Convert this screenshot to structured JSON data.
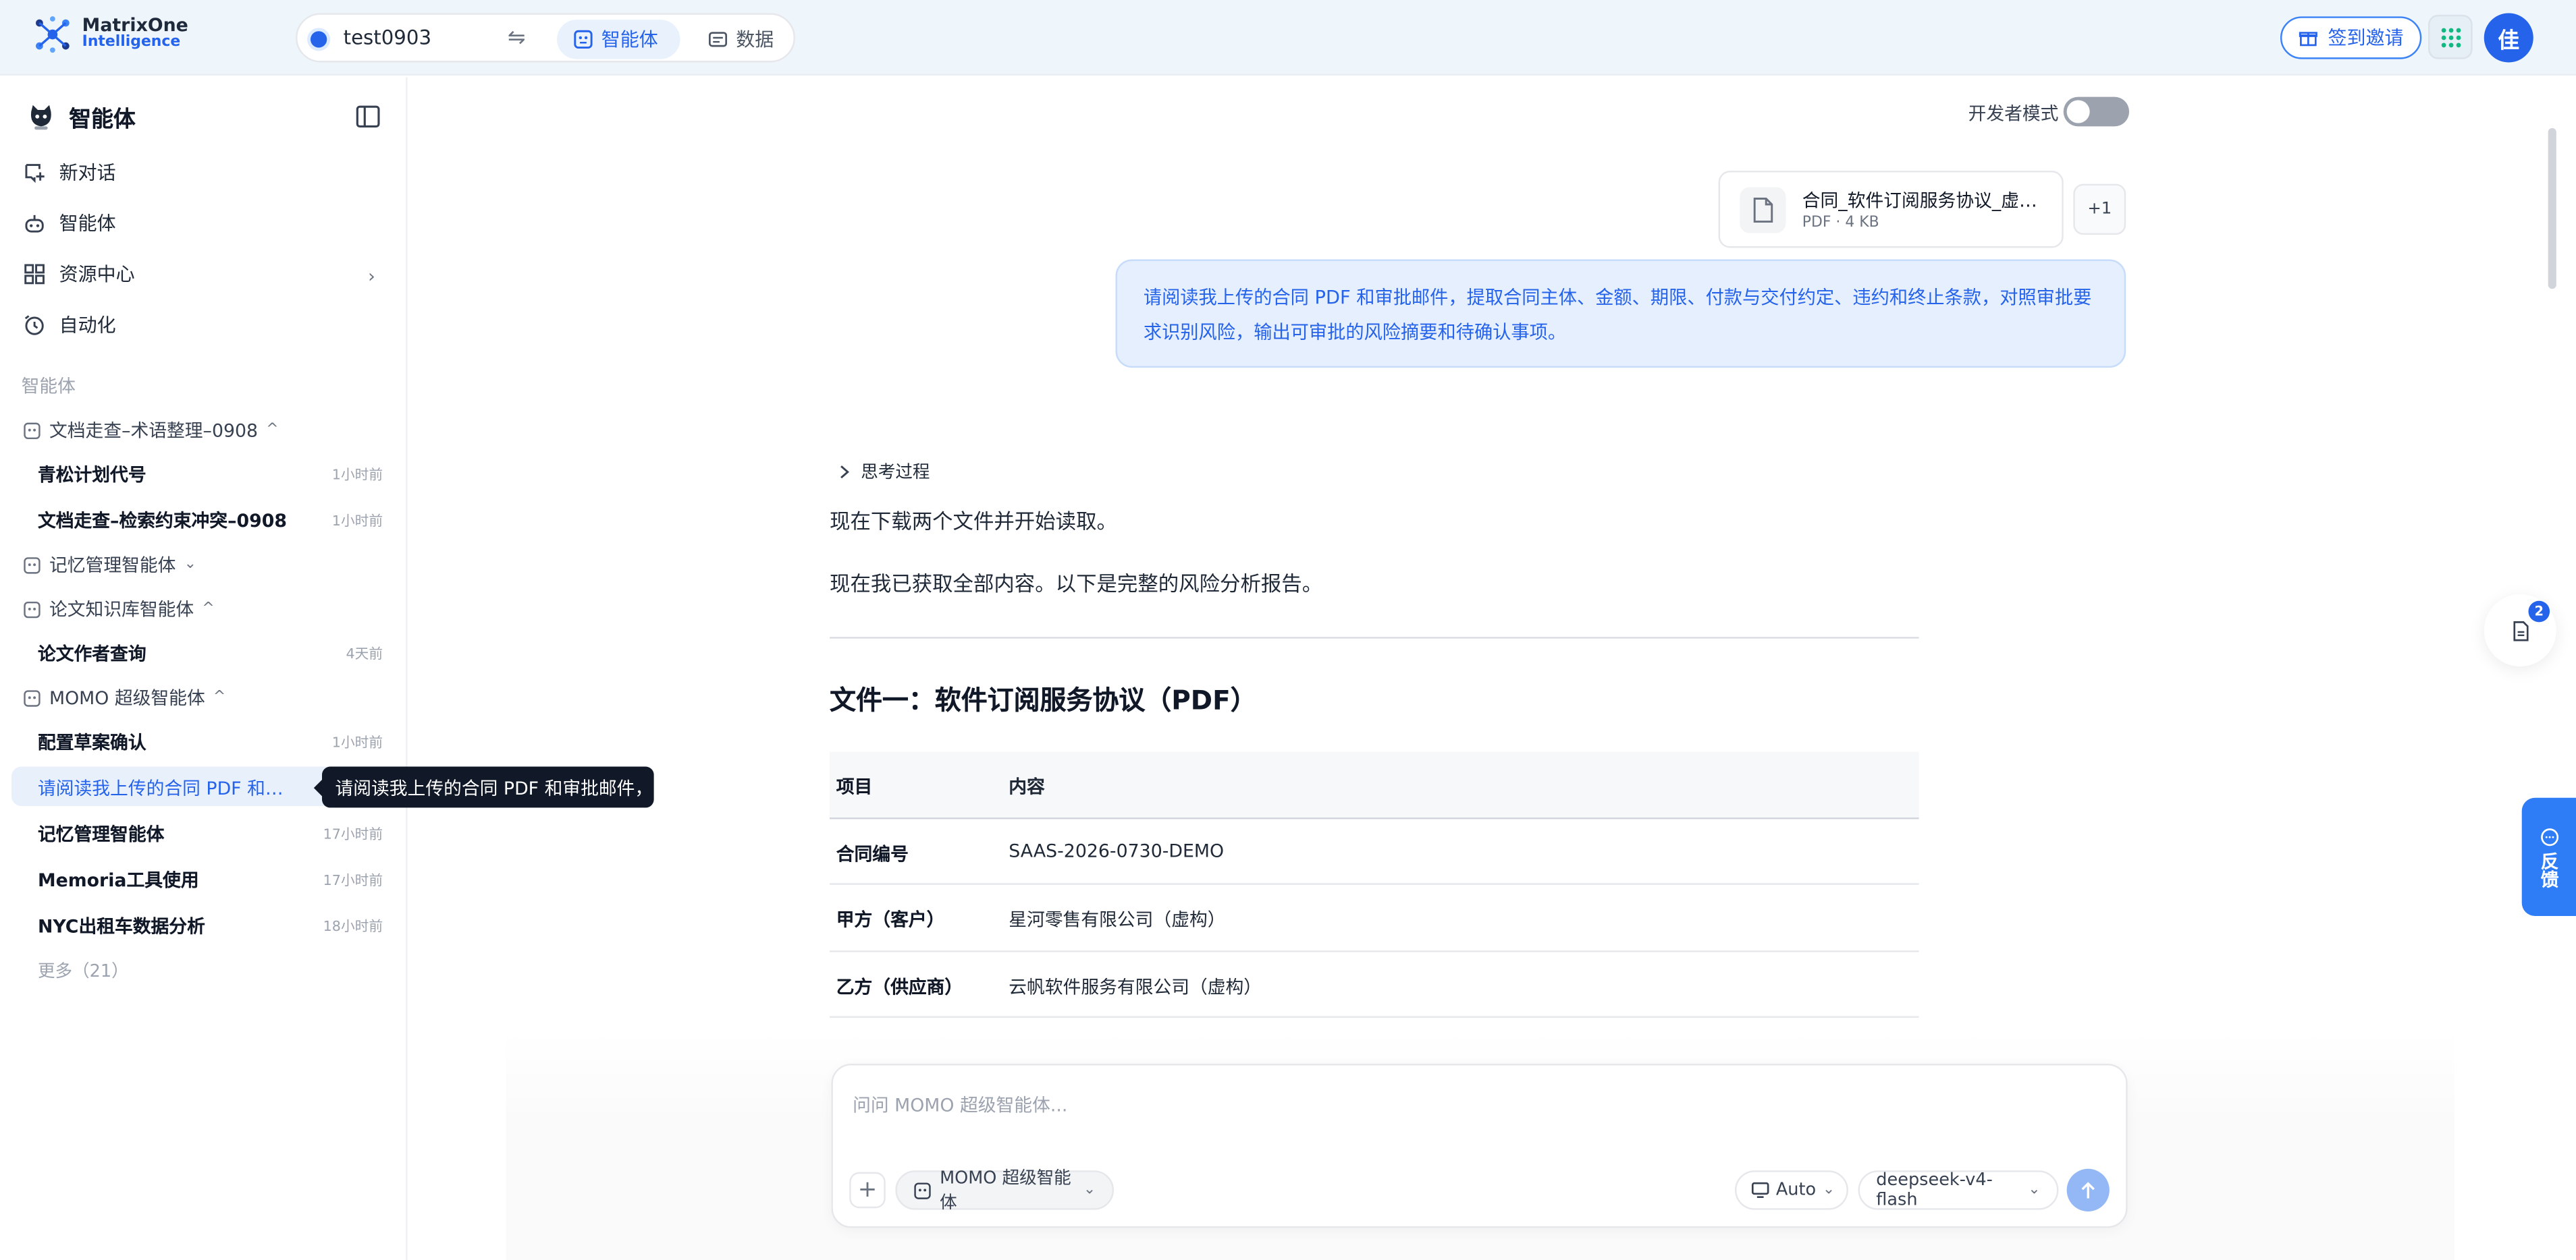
{
  "header": {
    "logo_line1": "MatrixOne",
    "logo_line2": "Intelligence",
    "workspace": "test0903",
    "tabs": [
      {
        "label": "智能体",
        "active": true
      },
      {
        "label": "数据",
        "active": false
      }
    ],
    "invite_label": "签到邀请",
    "avatar_text": "佳"
  },
  "sidebar": {
    "title": "智能体",
    "menu": [
      {
        "label": "新对话",
        "icon": "new-chat-icon"
      },
      {
        "label": "智能体",
        "icon": "agent-icon"
      },
      {
        "label": "资源中心",
        "icon": "grid-icon"
      },
      {
        "label": "自动化",
        "icon": "alarm-clock-icon"
      }
    ],
    "section_label": "智能体",
    "groups": [
      {
        "label": "文档走查–术语整理–0908",
        "expanded": true
      },
      {
        "label": "记忆管理智能体",
        "expanded": false
      },
      {
        "label": "论文知识库智能体",
        "expanded": true
      },
      {
        "label": "MOMO 超级智能体",
        "expanded": true
      }
    ],
    "conversations": [
      {
        "title": "青松计划代号",
        "time": "1小时前"
      },
      {
        "title": "文档走查–检索约束冲突–0908",
        "time": "1小时前"
      },
      {
        "title": "论文作者查询",
        "time": "4天前"
      },
      {
        "title": "配置草案确认",
        "time": "1小时前"
      },
      {
        "title": "请阅读我上传的合同 PDF 和审批邮件，",
        "time": ""
      },
      {
        "title": "记忆管理智能体",
        "time": "17小时前"
      },
      {
        "title": "Memoria工具使用",
        "time": "17小时前"
      },
      {
        "title": "NYC出租车数据分析",
        "time": "18小时前"
      }
    ],
    "more_label": "更多（21）",
    "tooltip": "请阅读我上传的合同 PDF 和审批邮件，"
  },
  "main": {
    "dev_mode_label": "开发者模式",
    "dev_mode_on": false,
    "attachment": {
      "name": "合同_软件订阅服务协议_虚构.pdf",
      "meta": "PDF · 4 KB",
      "extra_count": "+1"
    },
    "user_message": "请阅读我上传的合同 PDF 和审批邮件，提取合同主体、金额、期限、付款与交付约定、违约和终止条款，对照审批要求识别风险，输出可审批的风险摘要和待确认事项。",
    "thinking_label": "思考过程",
    "para1": "现在下载两个文件并开始读取。",
    "para2": "现在我已获取全部内容。以下是完整的风险分析报告。",
    "heading": "文件一：软件订阅服务协议（PDF）",
    "table": {
      "headers": [
        "项目",
        "内容"
      ],
      "rows": [
        [
          "合同编号",
          "SAAS-2026-0730-DEMO"
        ],
        [
          "甲方（客户）",
          "星河零售有限公司（虚构）"
        ],
        [
          "乙方（供应商）",
          "云帆软件服务有限公司（虚构）"
        ]
      ]
    }
  },
  "composer": {
    "placeholder": "问问 MOMO 超级智能体...",
    "agent_label": "MOMO 超级智能体",
    "mode_label": "Auto",
    "model_label": "deepseek-v4-flash"
  },
  "floating": {
    "doc_badge": "2",
    "feedback_label": "反馈"
  },
  "colors": {
    "accent": "#2563eb",
    "bubble_bg": "#e6effd",
    "active_item_bg": "#e8f0fc"
  }
}
